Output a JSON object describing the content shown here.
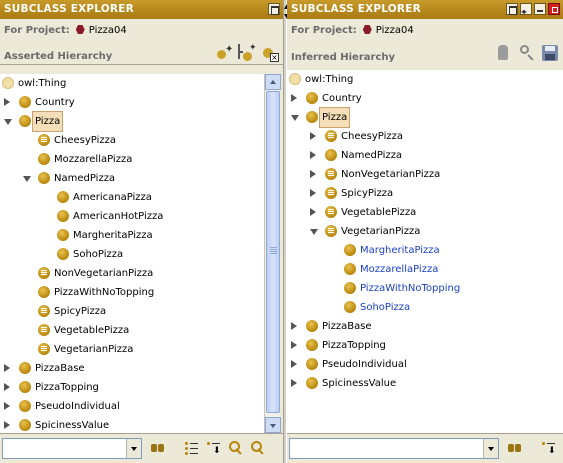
{
  "left": {
    "title": "SUBCLASS EXPLORER",
    "project_label": "For Project:",
    "project_name": "Pizza04",
    "hierarchy_title": "Asserted Hierarchy",
    "search": {
      "value": "",
      "placeholder": ""
    },
    "tree": [
      {
        "label": "owl:Thing",
        "indent": 0,
        "expander": "none",
        "icon": "thing"
      },
      {
        "label": "Country",
        "indent": 1,
        "expander": "closed",
        "icon": "class"
      },
      {
        "label": "Pizza",
        "indent": 1,
        "expander": "open",
        "icon": "class",
        "selected": true
      },
      {
        "label": "CheesyPizza",
        "indent": 2,
        "expander": "none",
        "icon": "defined"
      },
      {
        "label": "MozzarellaPizza",
        "indent": 2,
        "expander": "none",
        "icon": "class"
      },
      {
        "label": "NamedPizza",
        "indent": 2,
        "expander": "open",
        "icon": "class"
      },
      {
        "label": "AmericanaPizza",
        "indent": 3,
        "expander": "none",
        "icon": "class"
      },
      {
        "label": "AmericanHotPizza",
        "indent": 3,
        "expander": "none",
        "icon": "class"
      },
      {
        "label": "MargheritaPizza",
        "indent": 3,
        "expander": "none",
        "icon": "class"
      },
      {
        "label": "SohoPizza",
        "indent": 3,
        "expander": "none",
        "icon": "class"
      },
      {
        "label": "NonVegetarianPizza",
        "indent": 2,
        "expander": "none",
        "icon": "defined"
      },
      {
        "label": "PizzaWithNoTopping",
        "indent": 2,
        "expander": "none",
        "icon": "class"
      },
      {
        "label": "SpicyPizza",
        "indent": 2,
        "expander": "none",
        "icon": "defined"
      },
      {
        "label": "VegetablePizza",
        "indent": 2,
        "expander": "none",
        "icon": "defined"
      },
      {
        "label": "VegetarianPizza",
        "indent": 2,
        "expander": "none",
        "icon": "defined"
      },
      {
        "label": "PizzaBase",
        "indent": 1,
        "expander": "closed",
        "icon": "class"
      },
      {
        "label": "PizzaTopping",
        "indent": 1,
        "expander": "closed",
        "icon": "class"
      },
      {
        "label": "PseudoIndividual",
        "indent": 1,
        "expander": "closed",
        "icon": "class"
      },
      {
        "label": "SpicinessValue",
        "indent": 1,
        "expander": "closed",
        "icon": "class"
      }
    ]
  },
  "right": {
    "title": "SUBCLASS EXPLORER",
    "project_label": "For Project:",
    "project_name": "Pizza04",
    "hierarchy_title": "Inferred Hierarchy",
    "search": {
      "value": "",
      "placeholder": ""
    },
    "tree": [
      {
        "label": "owl:Thing",
        "indent": 0,
        "expander": "none",
        "icon": "thing"
      },
      {
        "label": "Country",
        "indent": 1,
        "expander": "closed",
        "icon": "class"
      },
      {
        "label": "Pizza",
        "indent": 1,
        "expander": "open",
        "icon": "class",
        "selected": true
      },
      {
        "label": "CheesyPizza",
        "indent": 2,
        "expander": "closed",
        "icon": "defined"
      },
      {
        "label": "NamedPizza",
        "indent": 2,
        "expander": "closed",
        "icon": "class"
      },
      {
        "label": "NonVegetarianPizza",
        "indent": 2,
        "expander": "closed",
        "icon": "defined"
      },
      {
        "label": "SpicyPizza",
        "indent": 2,
        "expander": "closed",
        "icon": "defined"
      },
      {
        "label": "VegetablePizza",
        "indent": 2,
        "expander": "closed",
        "icon": "defined"
      },
      {
        "label": "VegetarianPizza",
        "indent": 2,
        "expander": "open",
        "icon": "defined"
      },
      {
        "label": "MargheritaPizza",
        "indent": 3,
        "expander": "none",
        "icon": "class",
        "inferred": true
      },
      {
        "label": "MozzarellaPizza",
        "indent": 3,
        "expander": "none",
        "icon": "class",
        "inferred": true
      },
      {
        "label": "PizzaWithNoTopping",
        "indent": 3,
        "expander": "none",
        "icon": "class",
        "inferred": true
      },
      {
        "label": "SohoPizza",
        "indent": 3,
        "expander": "none",
        "icon": "class",
        "inferred": true
      },
      {
        "label": "PizzaBase",
        "indent": 1,
        "expander": "closed",
        "icon": "class"
      },
      {
        "label": "PizzaTopping",
        "indent": 1,
        "expander": "closed",
        "icon": "class"
      },
      {
        "label": "PseudoIndividual",
        "indent": 1,
        "expander": "closed",
        "icon": "class"
      },
      {
        "label": "SpicinessValue",
        "indent": 1,
        "expander": "closed",
        "icon": "class"
      }
    ]
  },
  "colors": {
    "titlebar": "#b8860b",
    "class_icon": "#c9a227",
    "inferred_text": "#1a3fc8",
    "project_icon": "#8b1a2b",
    "selection": "#f5dfb8"
  }
}
